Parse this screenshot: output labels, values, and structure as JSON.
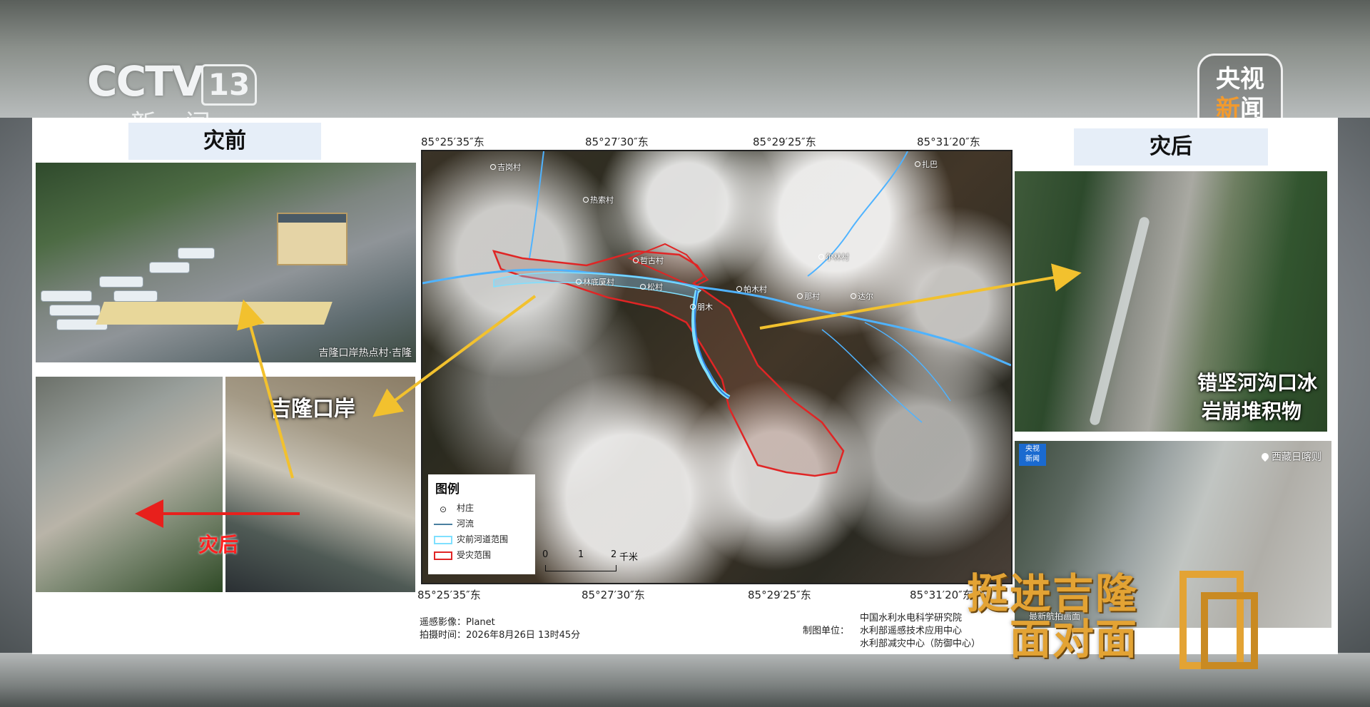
{
  "channel": {
    "logo_text": "CCTV",
    "number": "13",
    "subtitle": "新闻",
    "corner_logo_line1": "央视",
    "corner_logo_line2a": "新",
    "corner_logo_line2b": "闻"
  },
  "left": {
    "title": "灾前",
    "photo_caption": "吉隆口岸热点村·吉隆",
    "port_label": "吉隆口岸",
    "after_label": "灾后"
  },
  "map": {
    "top_coords": [
      "85°25′35″东",
      "85°27′30″东",
      "85°29′25″东",
      "85°31′20″东"
    ],
    "bottom_coords": [
      "85°25′35″东",
      "85°27′30″东",
      "85°29′25″东",
      "85°31′20″东"
    ],
    "labels": [
      "吉岗村",
      "热索村",
      "哲古村",
      "林底厦村",
      "松村",
      "帕木村",
      "朋木",
      "那村",
      "尔林村",
      "达尔",
      "扎巴"
    ],
    "legend": {
      "title": "图例",
      "items": [
        "村庄",
        "河流",
        "灾前河道范围",
        "受灾范围"
      ]
    },
    "scale": {
      "labels": [
        "0",
        "1",
        "2"
      ],
      "unit": "千米"
    },
    "source_line1": "遥感影像：Planet",
    "source_line2": "拍摄时间：2026年8月26日 13时45分",
    "maker_label": "制图单位：",
    "maker_line1": "中国水利水电科学研究院",
    "maker_line2": "水利部遥感技术应用中心",
    "maker_line3": "水利部减灾中心（防御中心）"
  },
  "right": {
    "title": "灾后",
    "caption_line1": "错坚河沟口冰",
    "caption_line2": "岩崩堆积物",
    "photo_tag_line1": "央视",
    "photo_tag_line2": "新闻",
    "location": "西藏日喀则",
    "photo_footer": "最新航拍画面"
  },
  "program": {
    "title_line1": "挺进吉隆",
    "title_line2": "面对面"
  },
  "colors": {
    "arrow_yellow": "#f2c12e",
    "arrow_red": "#e8201c",
    "river_blue": "#4fb3ff",
    "damage_red": "#e02525",
    "gold": "#e3a334"
  }
}
